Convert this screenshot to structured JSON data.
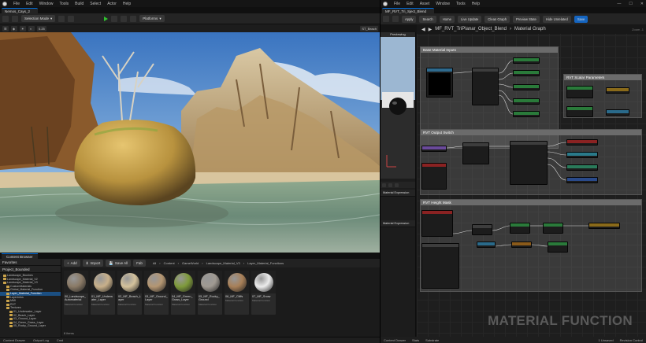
{
  "left_window": {
    "menu": [
      "File",
      "Edit",
      "Window",
      "Tools",
      "Build",
      "Select",
      "Actor",
      "Help"
    ],
    "tab": "Nemos_Cays_2",
    "toolbar": {
      "mode": "Selection Mode",
      "platforms": "Platforms"
    },
    "viewport": {
      "fov": "0.25",
      "outliner": "ST_Beach"
    },
    "content_browser": {
      "tab": "Content Browser",
      "favorites": "Favorites",
      "project": "Project_Bounded",
      "collections": "Collections",
      "add": "Add",
      "import": "Import",
      "save_all": "Save All",
      "fab": "Fab",
      "path": [
        "All",
        "Content",
        "GameWorld",
        "Landscape_Material_V3",
        "Layer_Material_Functions"
      ],
      "tree": [
        {
          "label": "Landscape_Brushes",
          "selected": false
        },
        {
          "label": "Landscape_Material_V2",
          "selected": false
        },
        {
          "label": "Landscape_Material_V3",
          "selected": false
        },
        {
          "label": "CustomMaterials",
          "selected": false
        },
        {
          "label": "Global_Material_Function",
          "selected": false
        },
        {
          "label": "Layer_Material_Function",
          "selected": true
        },
        {
          "label": "LayerInfos",
          "selected": false
        },
        {
          "label": "MMI",
          "selected": false
        },
        {
          "label": "RVT",
          "selected": false
        },
        {
          "label": "Textures",
          "selected": false
        },
        {
          "label": "01_Underwater_Layer",
          "selected": false
        },
        {
          "label": "02_Beach_Layer",
          "selected": false
        },
        {
          "label": "03_Ground_Layer",
          "selected": false
        },
        {
          "label": "04_Green_Grass_Layer",
          "selected": false
        },
        {
          "label": "05_Rocky_Ground_Layer",
          "selected": false
        }
      ],
      "assets": [
        {
          "name": "00_Landscape_Automaterial",
          "type": "Material Function",
          "color": "#8a7a66"
        },
        {
          "name": "01_MF_Underwater_Layer",
          "type": "Material Function",
          "color": "#c8b08a"
        },
        {
          "name": "02_MF_Beach_Layer",
          "type": "Material Function",
          "color": "#d4c29c"
        },
        {
          "name": "03_MF_Ground_Layer",
          "type": "Material Function",
          "color": "#b49672"
        },
        {
          "name": "04_MF_Green_Grass_Layer",
          "type": "Material Function",
          "color": "#7e9a3a"
        },
        {
          "name": "05_MF_Rocky_Ground",
          "type": "Material Function",
          "color": "#a09a92"
        },
        {
          "name": "06_MF_Cliffs",
          "type": "Material Function",
          "color": "#a88058"
        },
        {
          "name": "07_MF_Snow",
          "type": "Material Function",
          "color": "#ececec"
        }
      ],
      "count": "8 items"
    },
    "status": {
      "drawer": "Content Drawer",
      "output": "Output Log",
      "cmd": "Cmd"
    }
  },
  "right_window": {
    "menu": [
      "File",
      "Edit",
      "Asset",
      "Window",
      "Tools",
      "Help"
    ],
    "tab": "MF_RVT_Tri_Sject_Blend",
    "toolbar": [
      "Apply",
      "Search",
      "Home",
      "Live Update",
      "Clean Graph",
      "Preview State",
      "Hide Unrelated",
      "Save"
    ],
    "preview_label": "Previewing",
    "breadcrumb": [
      "MF_RVT_TriPlanar_Object_Blend",
      "Material Graph"
    ],
    "zoom": "Zoom -1",
    "details": [
      "Material Expression",
      ""
    ],
    "comments": [
      "Base Material Inputs",
      "RVT Scalar Parameters",
      "RVT Output Switch",
      "RVT Height Mask"
    ],
    "watermark": "MATERIAL FUNCTION",
    "status": {
      "drawer": "Content Drawer",
      "stats": "Stats",
      "substrate": "Substrate",
      "unsaved": "1 Unsaved",
      "revision": "Revision Control"
    }
  }
}
